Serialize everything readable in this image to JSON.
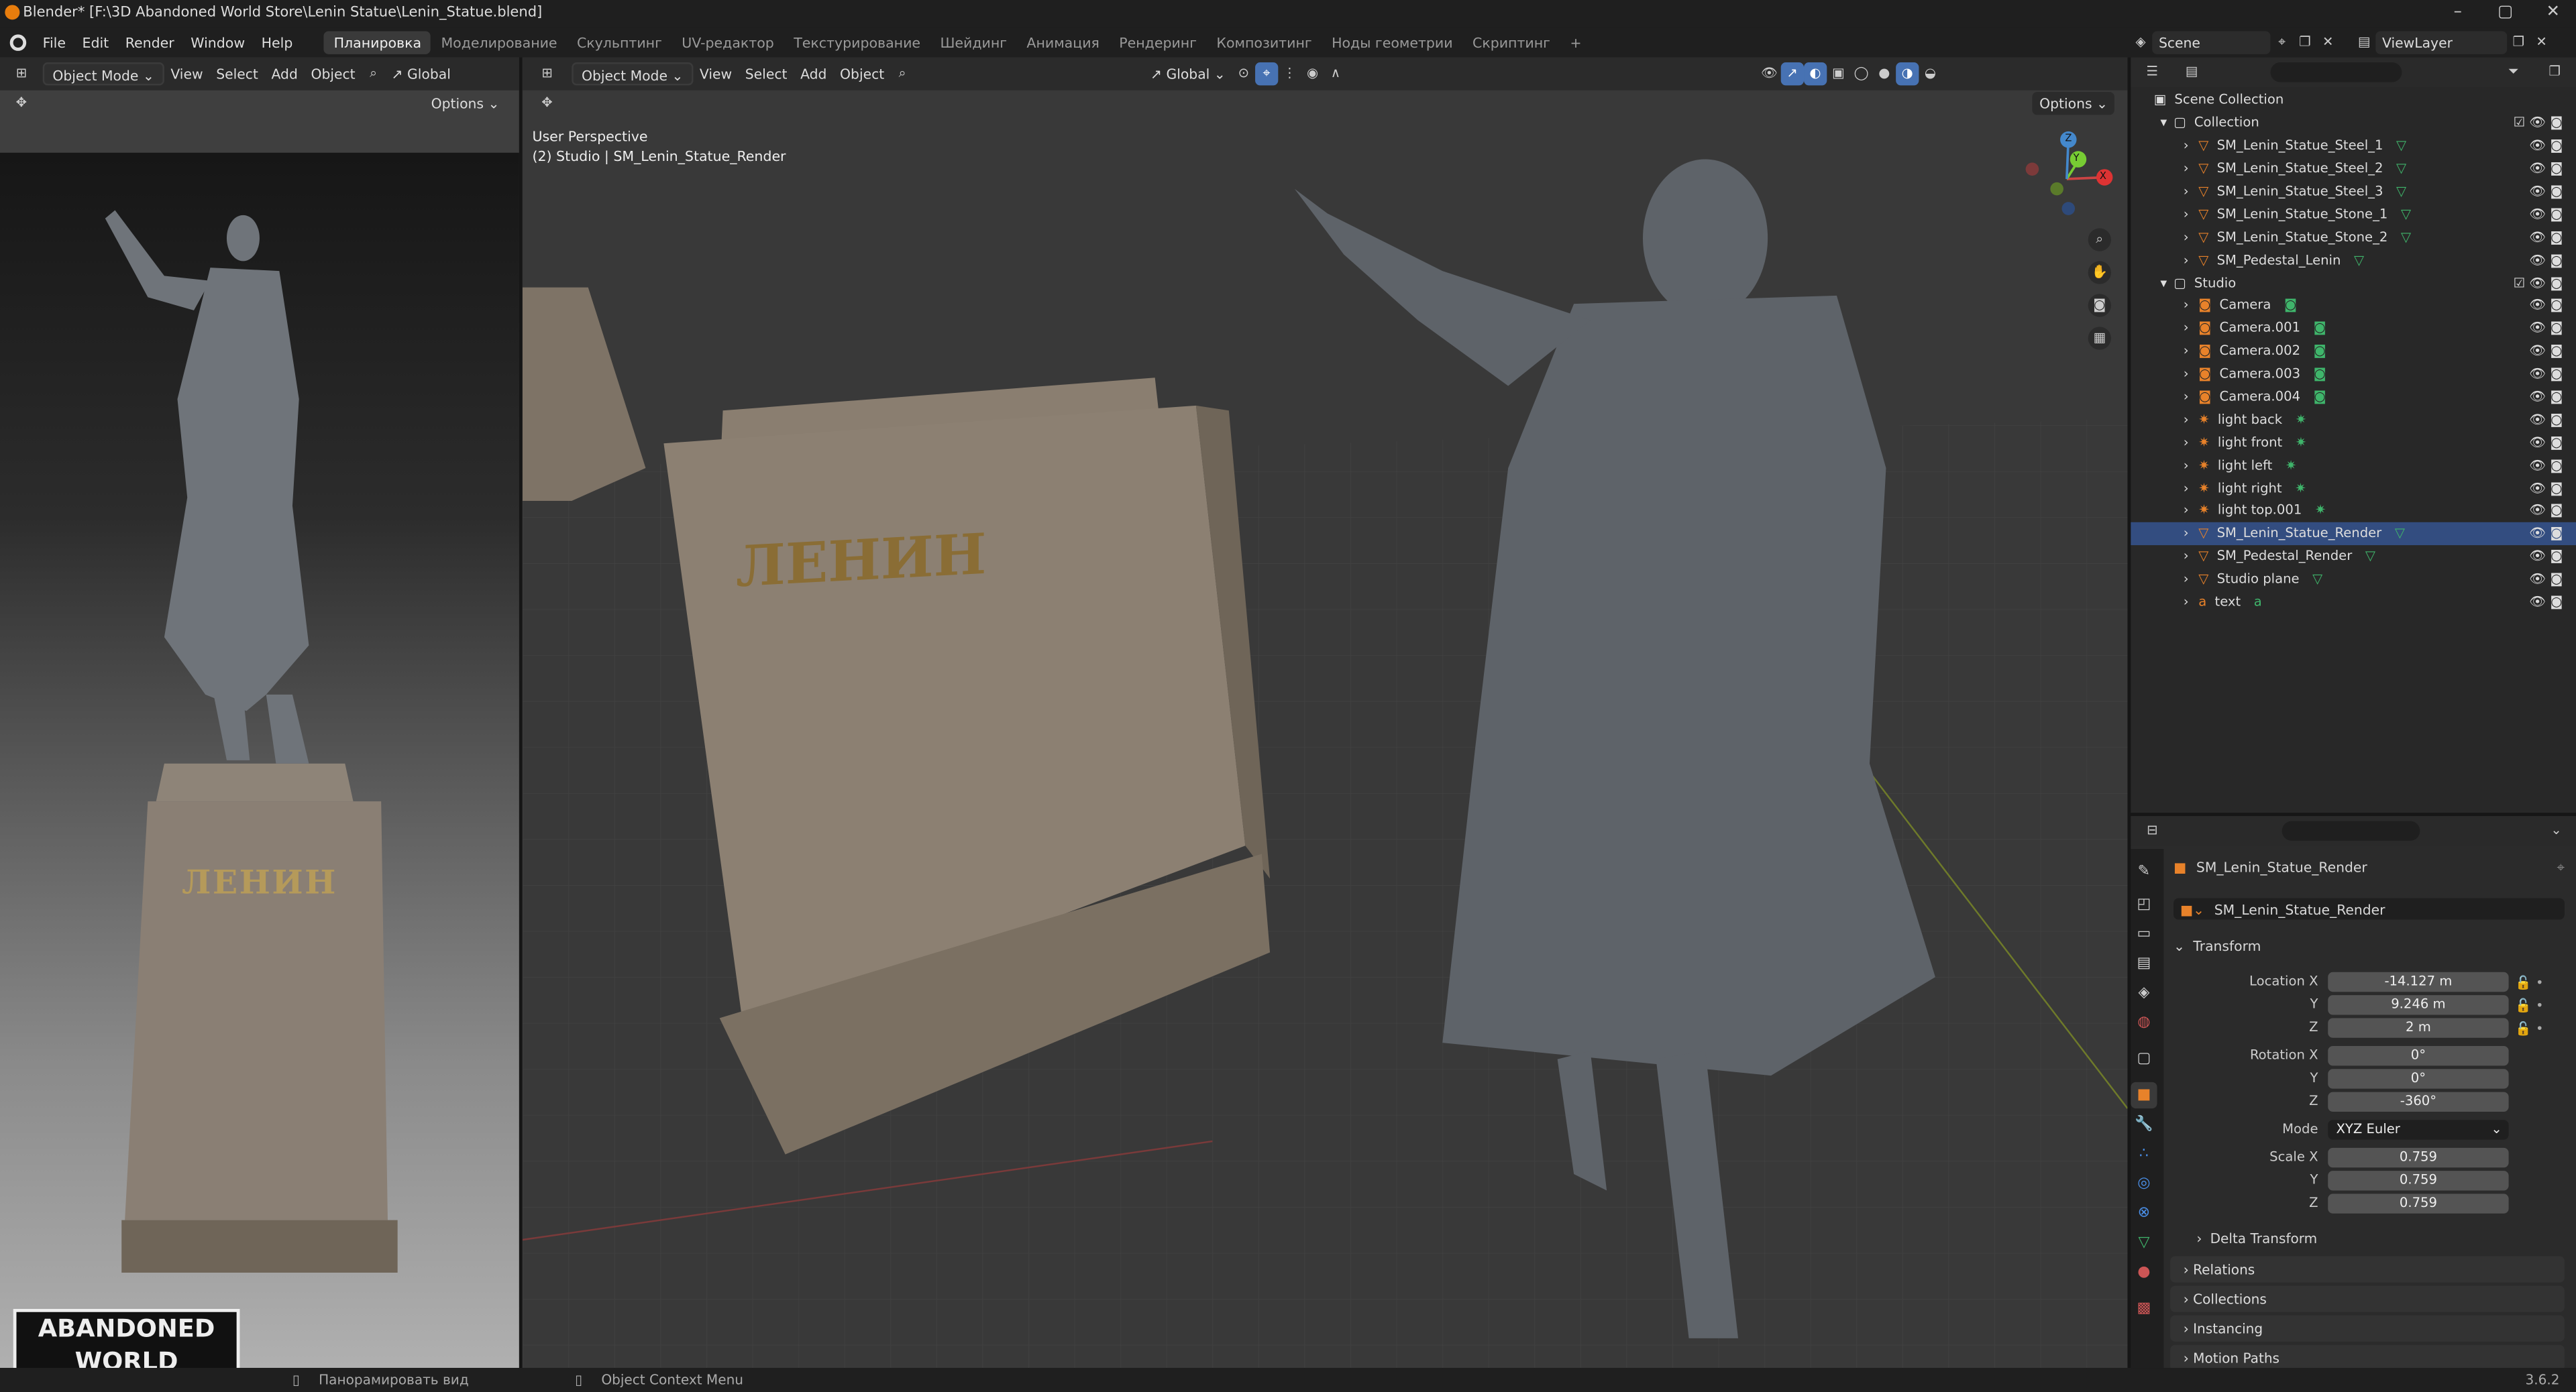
{
  "titlebar": {
    "title": "Blender* [F:\\3D Abandoned World Store\\Lenin Statue\\Lenin_Statue.blend]",
    "minimize": "–",
    "maximize": "▢",
    "close": "✕"
  },
  "menu": {
    "items": [
      "File",
      "Edit",
      "Render",
      "Window",
      "Help"
    ]
  },
  "workspaces": [
    "Планировка",
    "Моделирование",
    "Скульптинг",
    "UV-редактор",
    "Текстурирование",
    "Шейдинг",
    "Анимация",
    "Рендеринг",
    "Композитинг",
    "Ноды геометрии",
    "Скриптинг"
  ],
  "workspace_add": "+",
  "scene": {
    "label": "Scene",
    "viewlayer": "ViewLayer"
  },
  "left_viewport": {
    "mode": "Object Mode",
    "menus": [
      "View",
      "Select",
      "Add",
      "Object"
    ],
    "transform": "Global",
    "options": "Options"
  },
  "main_viewport": {
    "mode": "Object Mode",
    "menus": [
      "View",
      "Select",
      "Add",
      "Object"
    ],
    "transform": "Global",
    "options": "Options",
    "overlay_line1": "User Perspective",
    "overlay_line2": "(2) Studio | SM_Lenin_Statue_Render",
    "pedestal_text": "ЛЕНИН"
  },
  "gizmo": {
    "x": "X",
    "y": "Y",
    "z": "Z"
  },
  "left_pedestal_text": "ЛЕНИН",
  "logo": {
    "line1": "ABANDONED",
    "line2": "WORLD"
  },
  "outliner": {
    "root": "Scene Collection",
    "collections": [
      {
        "name": "Collection",
        "items": [
          "SM_Lenin_Statue_Steel_1",
          "SM_Lenin_Statue_Steel_2",
          "SM_Lenin_Statue_Steel_3",
          "SM_Lenin_Statue_Stone_1",
          "SM_Lenin_Statue_Stone_2",
          "SM_Pedestal_Lenin"
        ]
      },
      {
        "name": "Studio",
        "items": [
          "Camera",
          "Camera.001",
          "Camera.002",
          "Camera.003",
          "Camera.004",
          "light back",
          "light front",
          "light left",
          "light right",
          "light top.001",
          "SM_Lenin_Statue_Render",
          "SM_Pedestal_Render",
          "Studio plane",
          "text"
        ]
      }
    ],
    "selected": "SM_Lenin_Statue_Render"
  },
  "properties": {
    "object_name": "SM_Lenin_Statue_Render",
    "data_name": "SM_Lenin_Statue_Render",
    "transform_label": "Transform",
    "location": {
      "label": "Location X",
      "x": "-14.127 m",
      "y": "9.246 m",
      "z": "2 m"
    },
    "rotation": {
      "label": "Rotation X",
      "x": "0°",
      "y": "0°",
      "z": "-360°"
    },
    "mode": {
      "label": "Mode",
      "value": "XYZ Euler"
    },
    "scale": {
      "label": "Scale X",
      "x": "0.759",
      "y": "0.759",
      "z": "0.759"
    },
    "axis_y": "Y",
    "axis_z": "Z",
    "delta": "Delta Transform",
    "panels": [
      "Relations",
      "Collections",
      "Instancing",
      "Motion Paths"
    ]
  },
  "status": {
    "pan": "Панорамировать вид",
    "context": "Object Context Menu",
    "version": "3.6.2"
  },
  "colors": {
    "accent": "#4772b3",
    "selected_row": "#334d80",
    "mesh_icon": "#e8822a",
    "filter_icon": "#3fb56b"
  }
}
